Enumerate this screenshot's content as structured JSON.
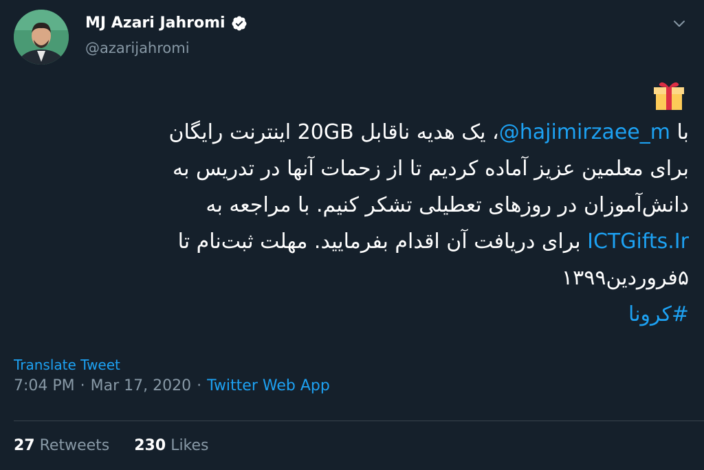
{
  "author": {
    "display_name": "MJ Azari Jahromi",
    "handle": "@azarijahromi",
    "verified_icon": "verified-badge-icon",
    "avatar_icon": "profile-photo"
  },
  "tweet": {
    "emoji": "wrapped-gift",
    "lines": [
      {
        "before": "با ",
        "link": "@hajimirzaee_m",
        "after": "، یک هدیه ناقابل 20GB اینترنت رایگان"
      },
      {
        "text": "برای معلمین عزیز آماده کردیم تا از زحمات آنها در تدریس به"
      },
      {
        "text": "دانش‌آموزان در روزهای تعطیلی تشکر کنیم. با مراجعه به"
      },
      {
        "link": "ICTGifts.Ir",
        "after": " برای دریافت آن اقدام بفرمایید. مهلت ثبت‌نام تا"
      },
      {
        "text": "۵فروردین۱۳۹۹"
      },
      {
        "link": "#کرونا"
      }
    ]
  },
  "translate_label": "Translate Tweet",
  "meta": {
    "time": "7:04 PM",
    "sep1": "·",
    "date": "Mar 17, 2020",
    "sep2": "·",
    "source": "Twitter Web App"
  },
  "stats": {
    "retweets_count": "27",
    "retweets_label": "Retweets",
    "likes_count": "230",
    "likes_label": "Likes"
  },
  "colors": {
    "background": "#15202b",
    "accent": "#1da1f2",
    "secondary_text": "#8899a6",
    "divider": "#38444d"
  }
}
